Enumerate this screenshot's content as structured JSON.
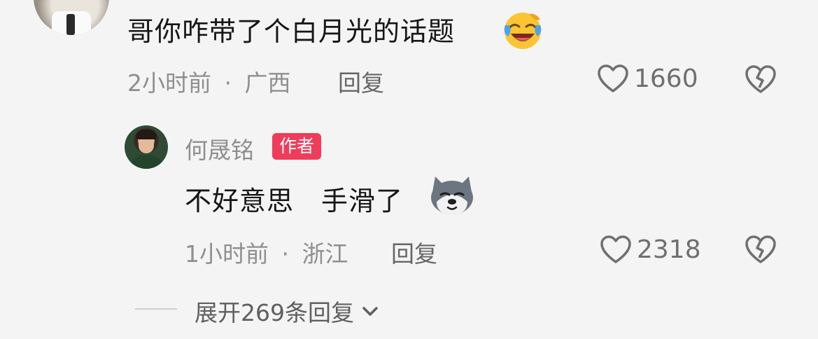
{
  "comment": {
    "text": "哥你咋带了个白月光的话题",
    "emoji_icon": "laughing-face-icon",
    "time": "2小时前",
    "dot": "·",
    "location": "广西",
    "reply_label": "回复",
    "like_count": "1660",
    "like_icon": "heart-outline-icon",
    "dislike_icon": "broken-heart-icon"
  },
  "reply": {
    "username": "何晟铭",
    "badge": "作者",
    "text": "不好意思　手滑了",
    "emoji_icon": "husky-dog-icon",
    "time": "1小时前",
    "dot": "·",
    "location": "浙江",
    "reply_label": "回复",
    "like_count": "2318",
    "like_icon": "heart-outline-icon",
    "dislike_icon": "broken-heart-icon"
  },
  "expand": {
    "label": "展开269条回复",
    "chevron_icon": "chevron-down-icon"
  },
  "colors": {
    "background": "#f4f4f4",
    "badge": "#f03c5b",
    "text_primary": "#161616",
    "text_meta": "#8f8f8f"
  }
}
